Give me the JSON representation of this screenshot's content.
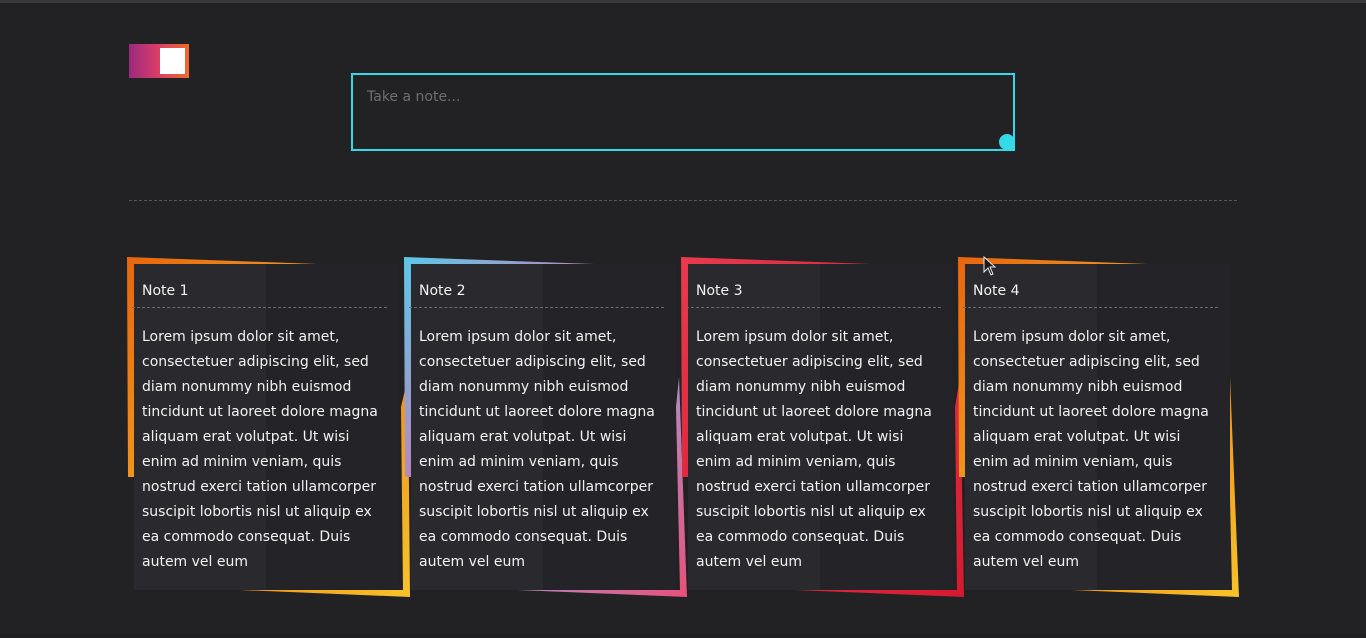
{
  "header": {
    "theme_toggle": {
      "state": "dark",
      "gradient": [
        "#9a2a7e",
        "#d63b6a",
        "#f06a2a"
      ],
      "knob_color": "#ffffff"
    }
  },
  "composer": {
    "placeholder": "Take a note...",
    "value": "",
    "border_color": "#33d9e6",
    "add_button_icon": "add-note-icon"
  },
  "notes": [
    {
      "title": "Note 1",
      "body": "Lorem ipsum dolor sit amet, consectetuer adipiscing elit, sed diam nonummy nibh euismod tincidunt ut laoreet dolore magna aliquam erat volutpat. Ut wisi enim ad minim veniam, quis nostrud exerci tation ullamcorper suscipit lobortis nisl ut aliquip ex ea commodo consequat. Duis autem vel eum",
      "frame_colors": [
        "#e8650e",
        "#f7c32a"
      ]
    },
    {
      "title": "Note 2",
      "body": "Lorem ipsum dolor sit amet, consectetuer adipiscing elit, sed diam nonummy nibh euismod tincidunt ut laoreet dolore magna aliquam erat volutpat. Ut wisi enim ad minim veniam, quis nostrud exerci tation ullamcorper suscipit lobortis nisl ut aliquip ex ea commodo consequat. Duis autem vel eum",
      "frame_colors": [
        "#5cc8e8",
        "#e8507a"
      ]
    },
    {
      "title": "Note 3",
      "body": "Lorem ipsum dolor sit amet, consectetuer adipiscing elit, sed diam nonummy nibh euismod tincidunt ut laoreet dolore magna aliquam erat volutpat. Ut wisi enim ad minim veniam, quis nostrud exerci tation ullamcorper suscipit lobortis nisl ut aliquip ex ea commodo consequat. Duis autem vel eum",
      "frame_colors": [
        "#e83a4e",
        "#d41a30"
      ]
    },
    {
      "title": "Note 4",
      "body": "Lorem ipsum dolor sit amet, consectetuer adipiscing elit, sed diam nonummy nibh euismod tincidunt ut laoreet dolore magna aliquam erat volutpat. Ut wisi enim ad minim veniam, quis nostrud exerci tation ullamcorper suscipit lobortis nisl ut aliquip ex ea commodo consequat. Duis autem vel eum",
      "frame_colors": [
        "#e8650e",
        "#f7c32a"
      ]
    }
  ],
  "colors": {
    "background": "#222225",
    "card_body": "#242428",
    "text": "#f2f2f2"
  }
}
